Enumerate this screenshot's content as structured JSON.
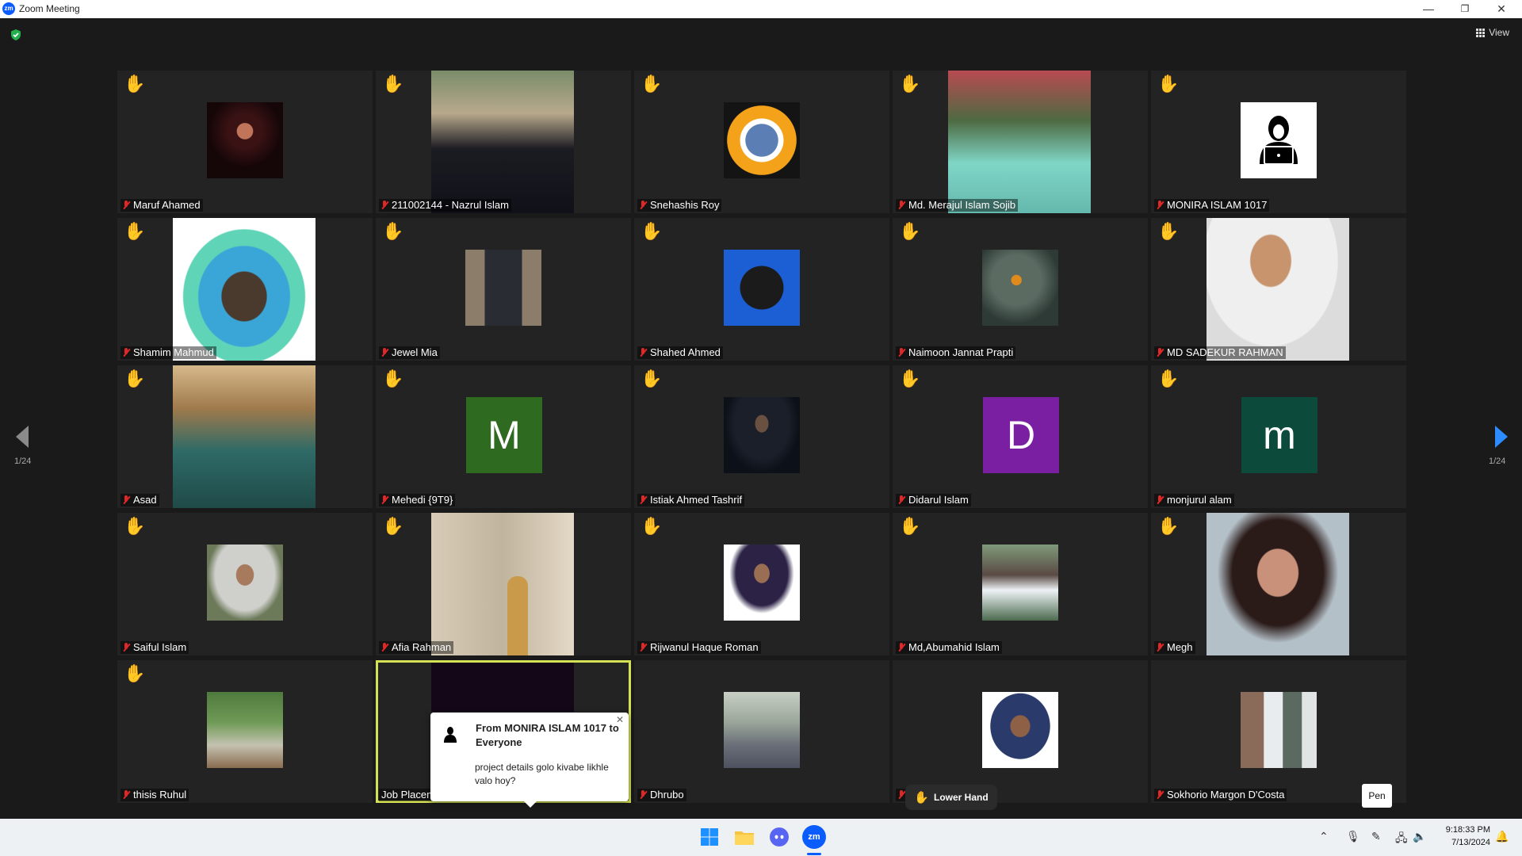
{
  "window": {
    "title": "Zoom Meeting",
    "logo": "zm",
    "minimize": "—",
    "restore": "❐",
    "close": "✕"
  },
  "toolbar": {
    "view_label": "View"
  },
  "paging": {
    "left": "1/24",
    "right": "1/24"
  },
  "tiles": [
    {
      "name": "Maruf Ahamed",
      "hand": true
    },
    {
      "name": "211002144 - Nazrul Islam",
      "hand": true
    },
    {
      "name": "Snehashis Roy",
      "hand": true
    },
    {
      "name": "Md. Merajul Islam Sojib",
      "hand": true
    },
    {
      "name": "MONIRA ISLAM 1017",
      "hand": true
    },
    {
      "name": "Shamim Mahmud",
      "hand": true
    },
    {
      "name": "Jewel Mia",
      "hand": true
    },
    {
      "name": "Shahed Ahmed",
      "hand": true
    },
    {
      "name": "Naimoon Jannat Prapti",
      "hand": true
    },
    {
      "name": "MD SADEKUR RAHMAN",
      "hand": true
    },
    {
      "name": "Asad",
      "hand": true
    },
    {
      "name": "Mehedi {9T9}",
      "hand": true,
      "letter": "M"
    },
    {
      "name": "Istiak Ahmed Tashrif",
      "hand": true
    },
    {
      "name": "Didarul Islam",
      "hand": true,
      "letter": "D"
    },
    {
      "name": "monjurul alam",
      "hand": true,
      "letter": "m"
    },
    {
      "name": "Saiful Islam",
      "hand": true
    },
    {
      "name": "Afia Rahman",
      "hand": true
    },
    {
      "name": "Rijwanul Haque Roman",
      "hand": true
    },
    {
      "name": "Md,Abumahid Islam",
      "hand": true
    },
    {
      "name": "Megh",
      "hand": true
    },
    {
      "name": "thisis Ruhul",
      "hand": true
    },
    {
      "name": "Job Placem",
      "hand": false
    },
    {
      "name": "Dhrubo",
      "hand": false
    },
    {
      "name": "",
      "hand": false
    },
    {
      "name": "Sokhorio Margon D'Costa",
      "hand": false
    }
  ],
  "chat_popup": {
    "from": "From MONIRA ISLAM 1017 to Everyone",
    "message": "project details golo kivabe likhle valo hoy?",
    "close": "✕"
  },
  "buttons": {
    "lower_hand": "Lower Hand",
    "pen": "Pen"
  },
  "taskbar": {
    "time": "9:18:33 PM",
    "date": "7/13/2024",
    "apps": [
      "start-icon",
      "file-explorer-icon",
      "discord-icon",
      "zoom-icon"
    ],
    "zoom_label": "zm"
  },
  "colors": {
    "hand": "#f4b400",
    "accent": "#2d8cff",
    "active_speaker": "#d4e157",
    "letter_m": "#2e6b20",
    "letter_d": "#7a1fa2",
    "letter_m2": "#0c4a3c"
  }
}
